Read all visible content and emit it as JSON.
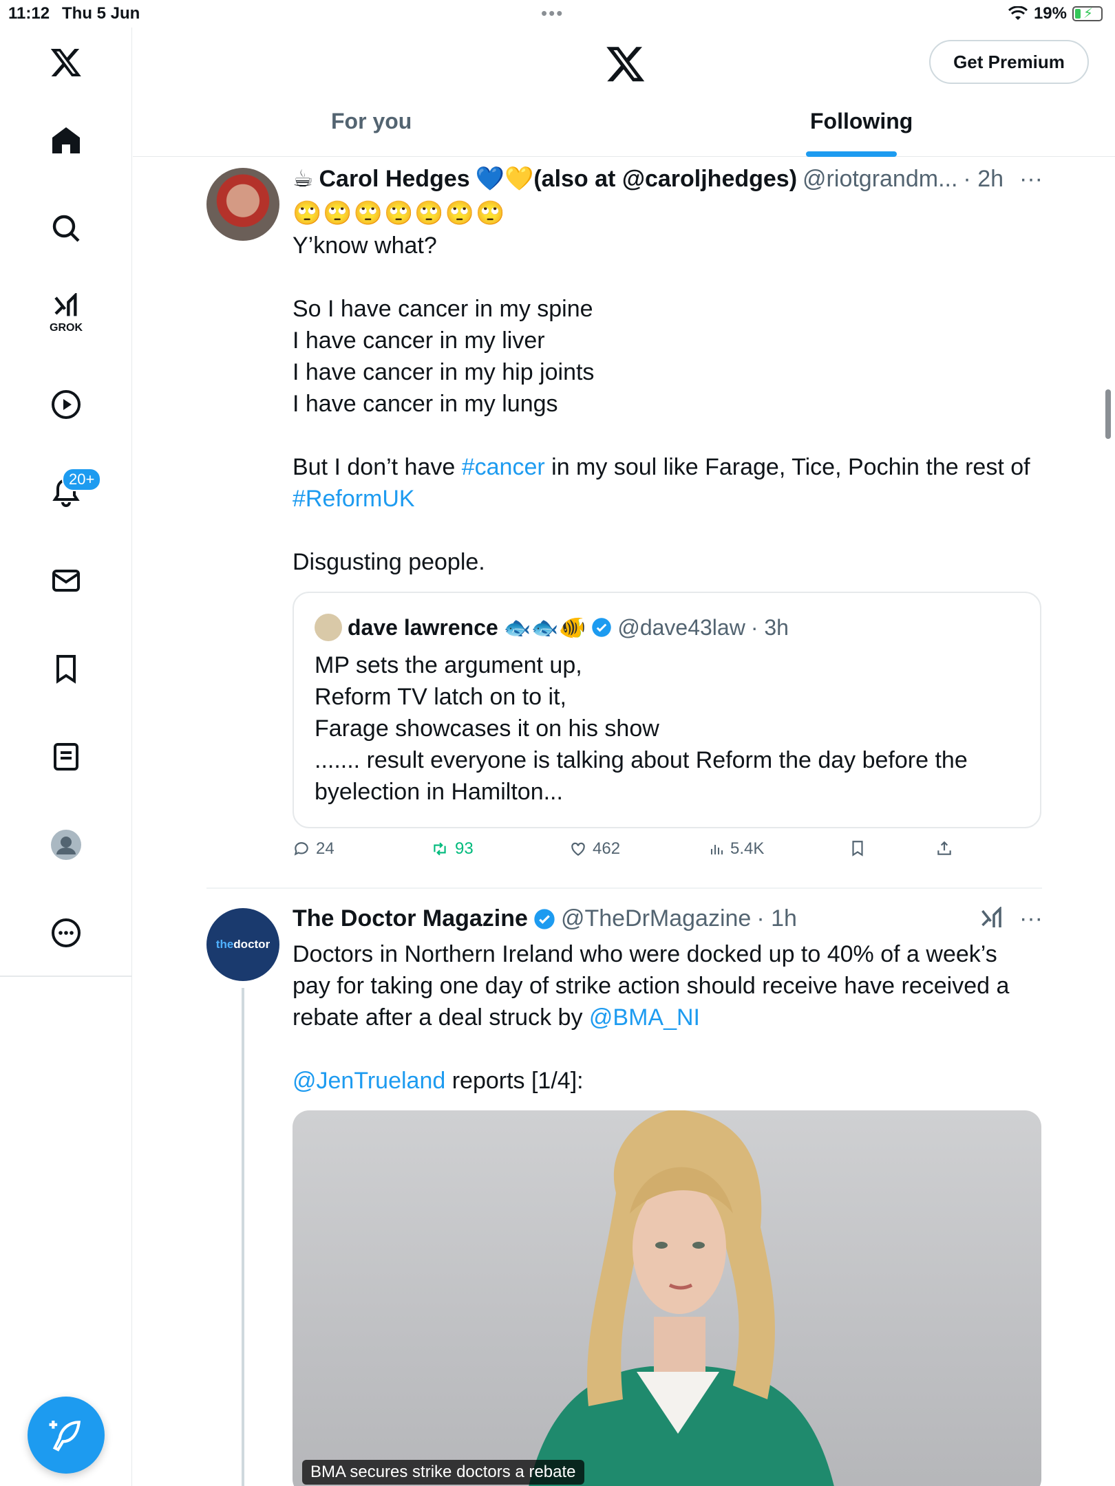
{
  "status": {
    "time": "11:12",
    "date": "Thu 5 Jun",
    "battery": "19%"
  },
  "sidebar": {
    "grok_label": "GROK",
    "notif_count": "20+"
  },
  "header": {
    "premium_label": "Get Premium",
    "tab_for_you": "For you",
    "tab_following": "Following"
  },
  "tweet1": {
    "prefix_emoji": "☕",
    "name": "Carol Hedges",
    "name_suffix": "💙💛(also at @caroljhedges)",
    "handle": "@riotgrandm...",
    "time": "· 2h",
    "emoji_row": "🙄🙄🙄🙄🙄🙄🙄",
    "text_a": "Y’know what?\n\nSo I have cancer in my spine\nI have cancer in my liver\nI have cancer in my hip joints\nI have cancer in my lungs\n\nBut I don’t have ",
    "hashtag1": "#cancer",
    "text_b": " in my soul like Farage, Tice, Pochin the rest of\n",
    "hashtag2": "#ReformUK",
    "text_c": "\n\nDisgusting people.",
    "quote": {
      "name": "dave lawrence",
      "name_emoji": "🐟🐟🐠",
      "handle": "@dave43law",
      "time": "· 3h",
      "text": "MP sets the argument up,\nReform TV latch on to it,\nFarage showcases it on his show\n....... result everyone is talking about Reform the day before the\nbyelection in Hamilton..."
    },
    "actions": {
      "replies": "24",
      "reposts": "93",
      "likes": "462",
      "views": "5.4K"
    }
  },
  "tweet2": {
    "avatar_text_a": "the",
    "avatar_text_b": "doctor",
    "name": "The Doctor Magazine",
    "handle": "@TheDrMagazine",
    "time": "· 1h",
    "text_a": "Doctors in Northern Ireland who were docked up to 40% of a week’s\npay for taking one day of strike action should receive have received a\nrebate after a deal struck by ",
    "mention1": "@BMA_NI",
    "text_b": "\n\n",
    "mention2": "@JenTrueland",
    "text_c": " reports [1/4]:",
    "media_caption": "BMA secures strike doctors a rebate"
  },
  "colors": {
    "accent": "#1d9bf0",
    "repost_green": "#00ba7c",
    "text": "#0f1419",
    "muted": "#536471"
  }
}
